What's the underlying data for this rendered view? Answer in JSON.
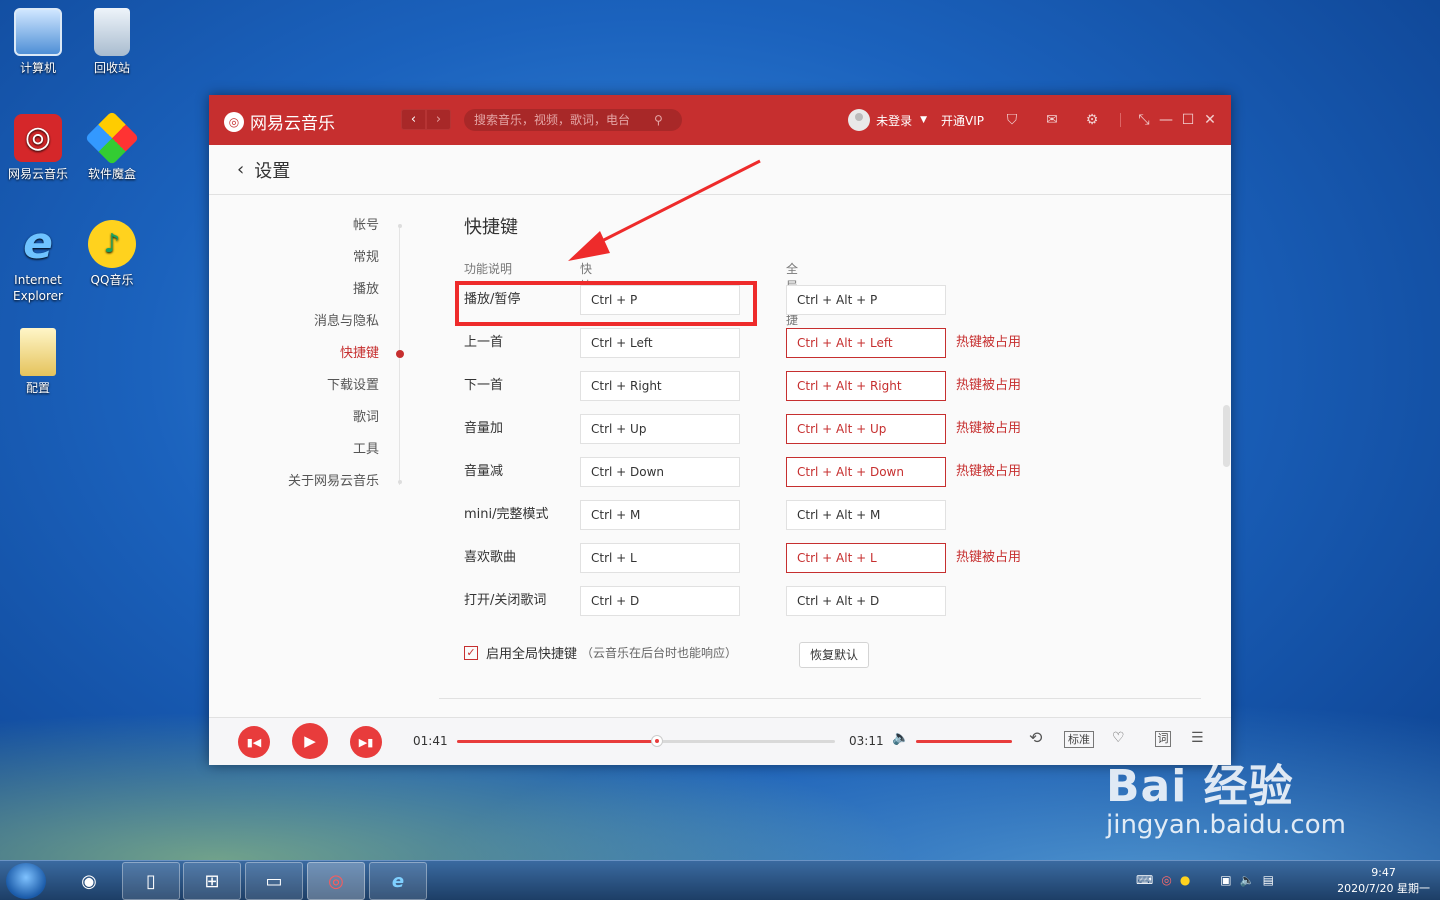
{
  "desktop": {
    "icons": [
      {
        "label": "计算机"
      },
      {
        "label": "回收站"
      },
      {
        "label": "网易云音乐"
      },
      {
        "label": "软件魔盒"
      },
      {
        "label": "Internet Explorer"
      },
      {
        "label": "QQ音乐"
      },
      {
        "label": "配置"
      }
    ]
  },
  "app": {
    "name": "网易云音乐",
    "logo_glyph": "◎",
    "search_placeholder": "搜索音乐，视频，歌词，电台",
    "user": "未登录",
    "vip": "开通VIP",
    "accent": "#c62f2f"
  },
  "page": {
    "back": "‹",
    "title": "设置"
  },
  "sidebar": {
    "items": [
      {
        "label": "帐号"
      },
      {
        "label": "常规"
      },
      {
        "label": "播放"
      },
      {
        "label": "消息与隐私"
      },
      {
        "label": "快捷键"
      },
      {
        "label": "下载设置"
      },
      {
        "label": "歌词"
      },
      {
        "label": "工具"
      },
      {
        "label": "关于网易云音乐"
      }
    ],
    "active_index": 4
  },
  "shortcuts": {
    "section_title": "快捷键",
    "col_function": "功能说明",
    "col_shortcut": "快捷键",
    "col_global": "全局快捷键",
    "occupied_label": "热键被占用",
    "rows": [
      {
        "name": "播放/暂停",
        "key": "Ctrl + P",
        "global": "Ctrl + Alt + P",
        "conflict": false
      },
      {
        "name": "上一首",
        "key": "Ctrl + Left",
        "global": "Ctrl + Alt + Left",
        "conflict": true
      },
      {
        "name": "下一首",
        "key": "Ctrl + Right",
        "global": "Ctrl + Alt + Right",
        "conflict": true
      },
      {
        "name": "音量加",
        "key": "Ctrl + Up",
        "global": "Ctrl + Alt + Up",
        "conflict": true
      },
      {
        "name": "音量减",
        "key": "Ctrl + Down",
        "global": "Ctrl + Alt + Down",
        "conflict": true
      },
      {
        "name": "mini/完整模式",
        "key": "Ctrl + M",
        "global": "Ctrl + Alt + M",
        "conflict": false
      },
      {
        "name": "喜欢歌曲",
        "key": "Ctrl + L",
        "global": "Ctrl + Alt + L",
        "conflict": true
      },
      {
        "name": "打开/关闭歌词",
        "key": "Ctrl + D",
        "global": "Ctrl + Alt + D",
        "conflict": false
      }
    ],
    "enable_label": "启用全局快捷键",
    "enable_note": "（云音乐在后台时也能响应）",
    "enable_checked": true,
    "restore_label": "恢复默认"
  },
  "player": {
    "current_time": "01:41",
    "total_time": "03:11",
    "progress": 0.53,
    "volume": 1.0,
    "quality": "标准",
    "lyric": "词"
  },
  "taskbar": {
    "time": "9:47",
    "date": "2020/7/20 星期一"
  },
  "watermark": {
    "brand": "Bai  经验",
    "url": "jingyan.baidu.com"
  }
}
